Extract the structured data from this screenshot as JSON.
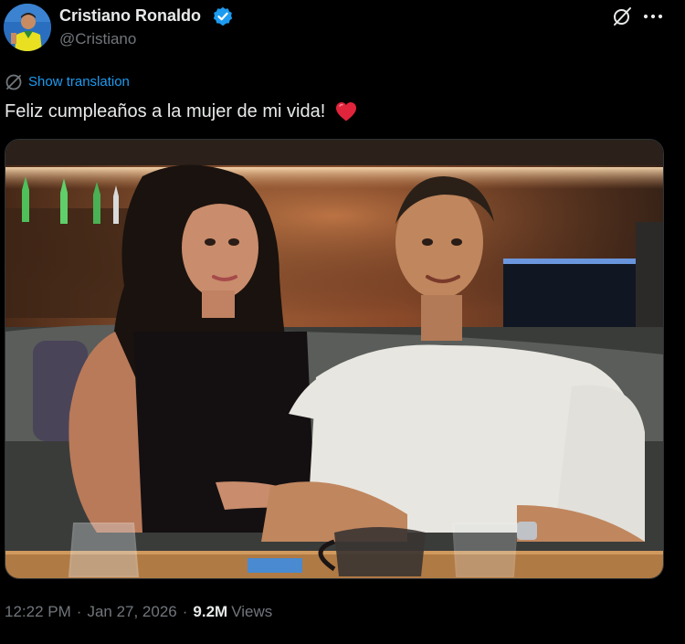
{
  "author": {
    "name": "Cristiano Ronaldo",
    "handle": "@Cristiano",
    "verified": true
  },
  "tweet": {
    "translation_label": "Show translation",
    "text": "Feliz cumpleaños a la mujer de mi vida!",
    "emoji_icon": "red-heart-icon"
  },
  "meta": {
    "time": "12:22 PM",
    "separator": "·",
    "date": "Jan 27, 2026",
    "views_count": "9.2M",
    "views_label": "Views"
  },
  "colors": {
    "background": "#000000",
    "text_primary": "#e7e9ea",
    "text_secondary": "#71767b",
    "accent_blue": "#1d9bf0",
    "heart_red": "#f91880"
  },
  "icons": {
    "verified": "verified-badge-icon",
    "grok": "grok-icon",
    "more": "more-icon",
    "translation": "globe-icon"
  }
}
